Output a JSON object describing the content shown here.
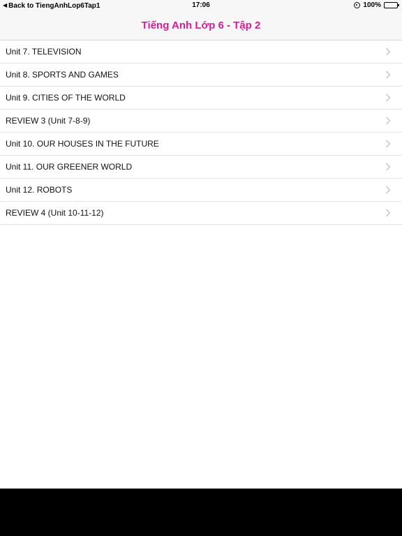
{
  "status_bar": {
    "back_label": "Back to TiengAnhLop6Tap1",
    "time": "17:06",
    "battery": "100%"
  },
  "nav": {
    "title": "Tiếng Anh Lớp 6 - Tập 2"
  },
  "list": {
    "items": [
      {
        "label": "Unit 7. TELEVISION"
      },
      {
        "label": "Unit 8. SPORTS AND GAMES"
      },
      {
        "label": "Unit 9. CITIES OF THE WORLD"
      },
      {
        "label": "REVIEW 3 (Unit 7-8-9)"
      },
      {
        "label": "Unit 10. OUR HOUSES IN THE FUTURE"
      },
      {
        "label": "Unit 11. OUR GREENER WORLD"
      },
      {
        "label": "Unit 12. ROBOTS"
      },
      {
        "label": "REVIEW 4 (Unit 10-11-12)"
      }
    ]
  },
  "colors": {
    "title": "#d1209a",
    "battery": "#4cd964"
  },
  "icons": {
    "back": "back-caret-icon",
    "orientation_lock": "orientation-lock-icon",
    "battery": "battery-icon",
    "row_disclosure": "chevron-right-icon"
  }
}
